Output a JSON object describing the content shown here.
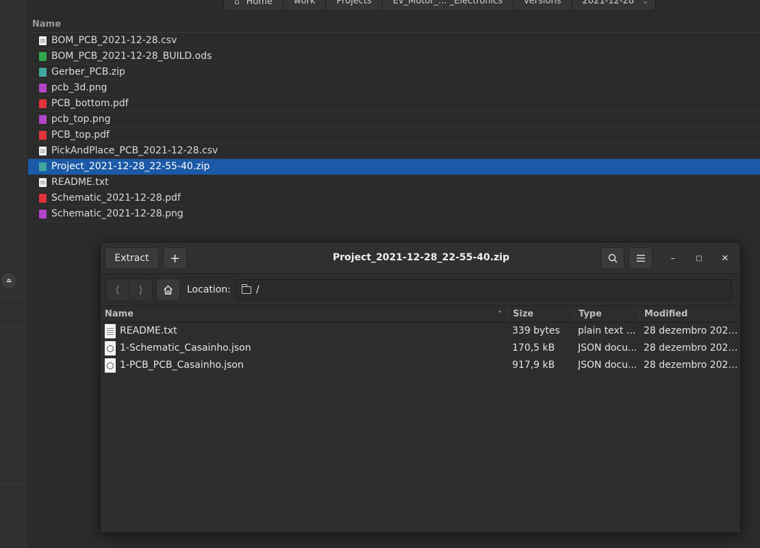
{
  "file_manager": {
    "breadcrumbs": [
      "Home",
      "work",
      "Projects",
      "Ev_Motor_... _Electronics",
      "versions",
      "2021-12-28"
    ],
    "column_name": "Name",
    "files": [
      {
        "name": "BOM_PCB_2021-12-28.csv",
        "icon": "text-file-icon"
      },
      {
        "name": "BOM_PCB_2021-12-28_BUILD.ods",
        "icon": "spreadsheet-icon"
      },
      {
        "name": "Gerber_PCB.zip",
        "icon": "archive-icon"
      },
      {
        "name": "pcb_3d.png",
        "icon": "image-icon"
      },
      {
        "name": "PCB_bottom.pdf",
        "icon": "pdf-icon"
      },
      {
        "name": "pcb_top.png",
        "icon": "image-icon"
      },
      {
        "name": "PCB_top.pdf",
        "icon": "pdf-icon"
      },
      {
        "name": "PickAndPlace_PCB_2021-12-28.csv",
        "icon": "text-file-icon"
      },
      {
        "name": "Project_2021-12-28_22-55-40.zip",
        "icon": "archive-icon"
      },
      {
        "name": "README.txt",
        "icon": "text-file-icon"
      },
      {
        "name": "Schematic_2021-12-28.pdf",
        "icon": "pdf-icon"
      },
      {
        "name": "Schematic_2021-12-28.png",
        "icon": "image-icon"
      }
    ],
    "selected_color": "#1c59a6"
  },
  "archive": {
    "title": "Project_2021-12-28_22-55-40.zip",
    "extract_label": "Extract",
    "add_label": "+",
    "location_label": "Location:",
    "location_path": "/",
    "columns": {
      "name": "Name",
      "size": "Size",
      "type": "Type",
      "modified": "Modified"
    },
    "entries": [
      {
        "name": "README.txt",
        "size": "339 bytes",
        "type": "plain text d...",
        "modified": "28 dezembro 2021,...",
        "icon": "text-file-icon"
      },
      {
        "name": "1-Schematic_Casainho.json",
        "size": "170,5 kB",
        "type": "JSON docu...",
        "modified": "28 dezembro 2021,...",
        "icon": "json-file-icon"
      },
      {
        "name": "1-PCB_PCB_Casainho.json",
        "size": "917,9 kB",
        "type": "JSON docu...",
        "modified": "28 dezembro 2021,...",
        "icon": "json-file-icon"
      }
    ]
  }
}
